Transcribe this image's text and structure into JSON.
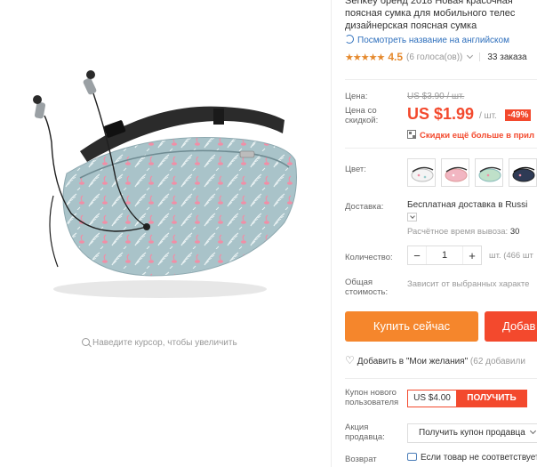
{
  "product": {
    "title_lines": [
      "Senkey бренд 2018 Новая красочная",
      "поясная сумка для мобильного телес",
      "дизайнерская поясная сумка"
    ],
    "translate_link": "Посмотреть название на английском",
    "rating": {
      "stars": 4.5,
      "stars_text": "★★★★★",
      "value": "4.5",
      "votes": "(6 голоса(ов))",
      "orders": "33 заказа"
    }
  },
  "gallery": {
    "zoom_hint": "Наведите курсор, чтобы увеличить",
    "colors": {
      "bag_body": "#a9c3c9",
      "strap": "#2b2b2b",
      "flamingo": "#f18ea6",
      "leaf": "#e8f1f2"
    }
  },
  "pricing": {
    "price_label": "Цена:",
    "old_price": "US $3.90 / шт.",
    "discount_price_label_1": "Цена со",
    "discount_price_label_2": "скидкой:",
    "price": "US $1.99",
    "per_unit": "/ шт.",
    "discount_badge": "-49%",
    "promo_text": "Скидки ещё больше в прил",
    "accent_color": "#f3492d"
  },
  "options": {
    "color_label": "Цвет:",
    "swatches": [
      {
        "name": "белая",
        "color": "#f4f4f4"
      },
      {
        "name": "розовая",
        "color": "#f2b6c2"
      },
      {
        "name": "зелёная",
        "color": "#bfe0c9"
      },
      {
        "name": "тёмно-синяя",
        "color": "#2e3a55"
      }
    ]
  },
  "shipping": {
    "label": "Доставка:",
    "value": "Бесплатная доставка в Russi",
    "delivery_time_label": "Расчётное время вывоза:",
    "delivery_time_value": "30"
  },
  "quantity": {
    "label": "Количество:",
    "minus": "−",
    "value": "1",
    "plus": "+",
    "stock": "шт. (466 шт"
  },
  "total": {
    "label_1": "Общая",
    "label_2": "стоимость:",
    "value": "Зависит от выбранных характе"
  },
  "actions": {
    "buy_now": "Купить сейчас",
    "add_to_cart": "Добав",
    "wishlist_label": "Добавить в \"Мои желания\"",
    "wishlist_count": "(62 добавили"
  },
  "coupons": {
    "new_user_label_1": "Купон нового",
    "new_user_label_2": "пользователя",
    "new_user_value": "US $4.00",
    "get_button": "ПОЛУЧИТЬ",
    "seller_label_1": "Акция",
    "seller_label_2": "продавца:",
    "seller_select": "Получить купон продавца",
    "return_label": "Возврат",
    "return_value": "Если товар не соответствует"
  }
}
